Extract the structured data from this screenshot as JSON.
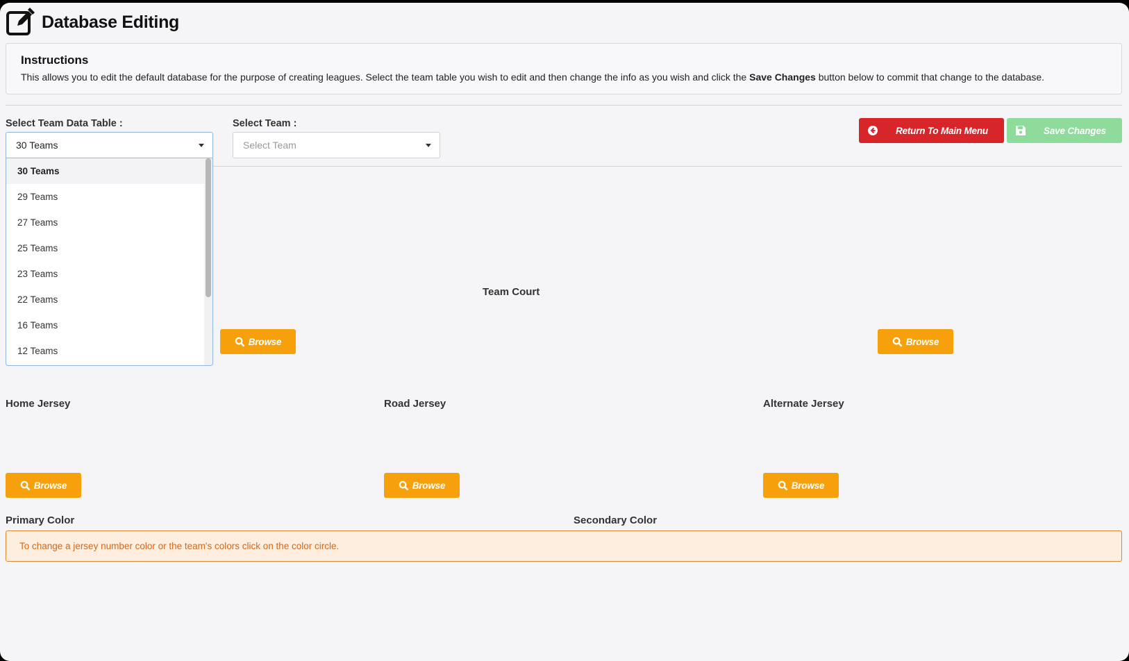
{
  "header": {
    "title": "Database Editing",
    "icon": "edit-icon"
  },
  "instructions": {
    "title": "Instructions",
    "text_before": "This allows you to edit the default database for the purpose of creating leagues. Select the team table you wish to edit and then change the info as you wish and click the ",
    "text_bold": "Save Changes",
    "text_after": " button below to commit that change to the database."
  },
  "team_table": {
    "label": "Select Team Data Table :",
    "value": "30 Teams",
    "options": [
      "30 Teams",
      "29 Teams",
      "27 Teams",
      "25 Teams",
      "23 Teams",
      "22 Teams",
      "16 Teams",
      "12 Teams"
    ]
  },
  "team_select": {
    "label": "Select Team :",
    "placeholder": "Select Team"
  },
  "buttons": {
    "return_label": "Return To Main Menu",
    "save_label": "Save Changes",
    "browse_label": "Browse"
  },
  "sections": {
    "team_court": "Team Court",
    "home_jersey": "Home Jersey",
    "road_jersey": "Road Jersey",
    "alternate_jersey": "Alternate Jersey",
    "primary_color": "Primary Color",
    "secondary_color": "Secondary Color"
  },
  "alert": {
    "text": "To change a jersey number color or the team's colors click on the color circle."
  },
  "colors": {
    "accent_red": "#d8252a",
    "save_green": "#8edb9b",
    "browse_orange": "#f6a10b",
    "alert_bg": "#fdeee0",
    "alert_text": "#d2691e"
  }
}
